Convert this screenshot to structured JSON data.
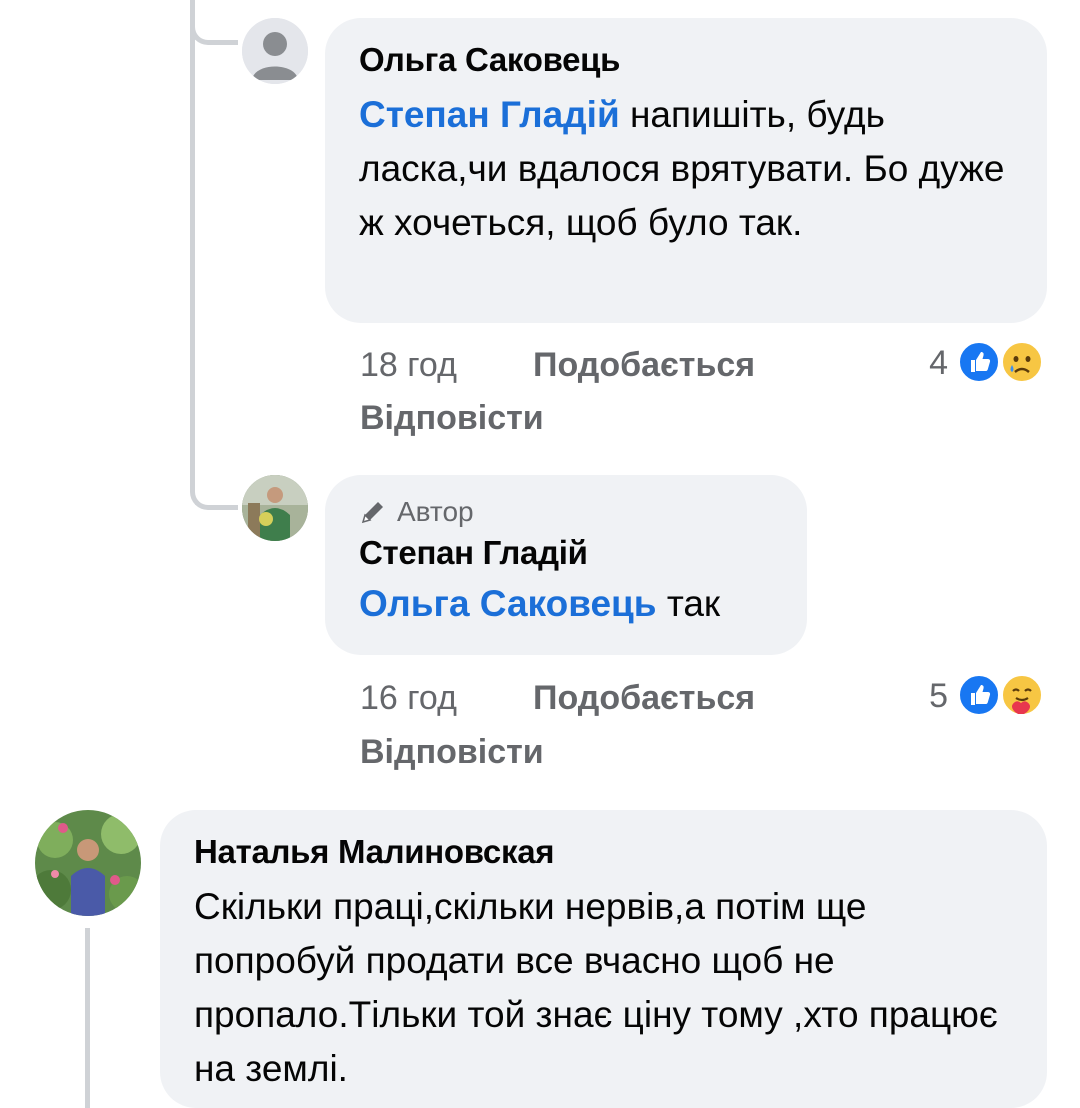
{
  "comments": [
    {
      "author": "Ольга Саковець",
      "mention": "Степан Гладій",
      "text": "напишіть, будь ласка,чи вдалося врятувати. Бо дуже ж хочеться, щоб було так.",
      "time": "18 год",
      "like_label": "Подобається",
      "reply_label": "Відповісти",
      "reaction_count": "4",
      "reactions": [
        "like-icon",
        "sad-icon"
      ]
    },
    {
      "badge": "Автор",
      "author": "Степан Гладій",
      "mention": "Ольга Саковець",
      "text": "так",
      "time": "16 год",
      "like_label": "Подобається",
      "reply_label": "Відповісти",
      "reaction_count": "5",
      "reactions": [
        "like-icon",
        "care-icon"
      ]
    },
    {
      "author": "Наталья Малиновская",
      "text": "Скільки праці,скільки нервів,а потім ще попробуй продати все вчасно щоб не пропало.Тільки той знає ціну тому ,хто працює на землі."
    }
  ],
  "colors": {
    "bubble_bg": "#f0f2f5",
    "mention_blue": "#1b6fd8",
    "meta_gray": "#65676b",
    "like_blue": "#1877f2",
    "emoji_yellow": "#f7c643"
  }
}
